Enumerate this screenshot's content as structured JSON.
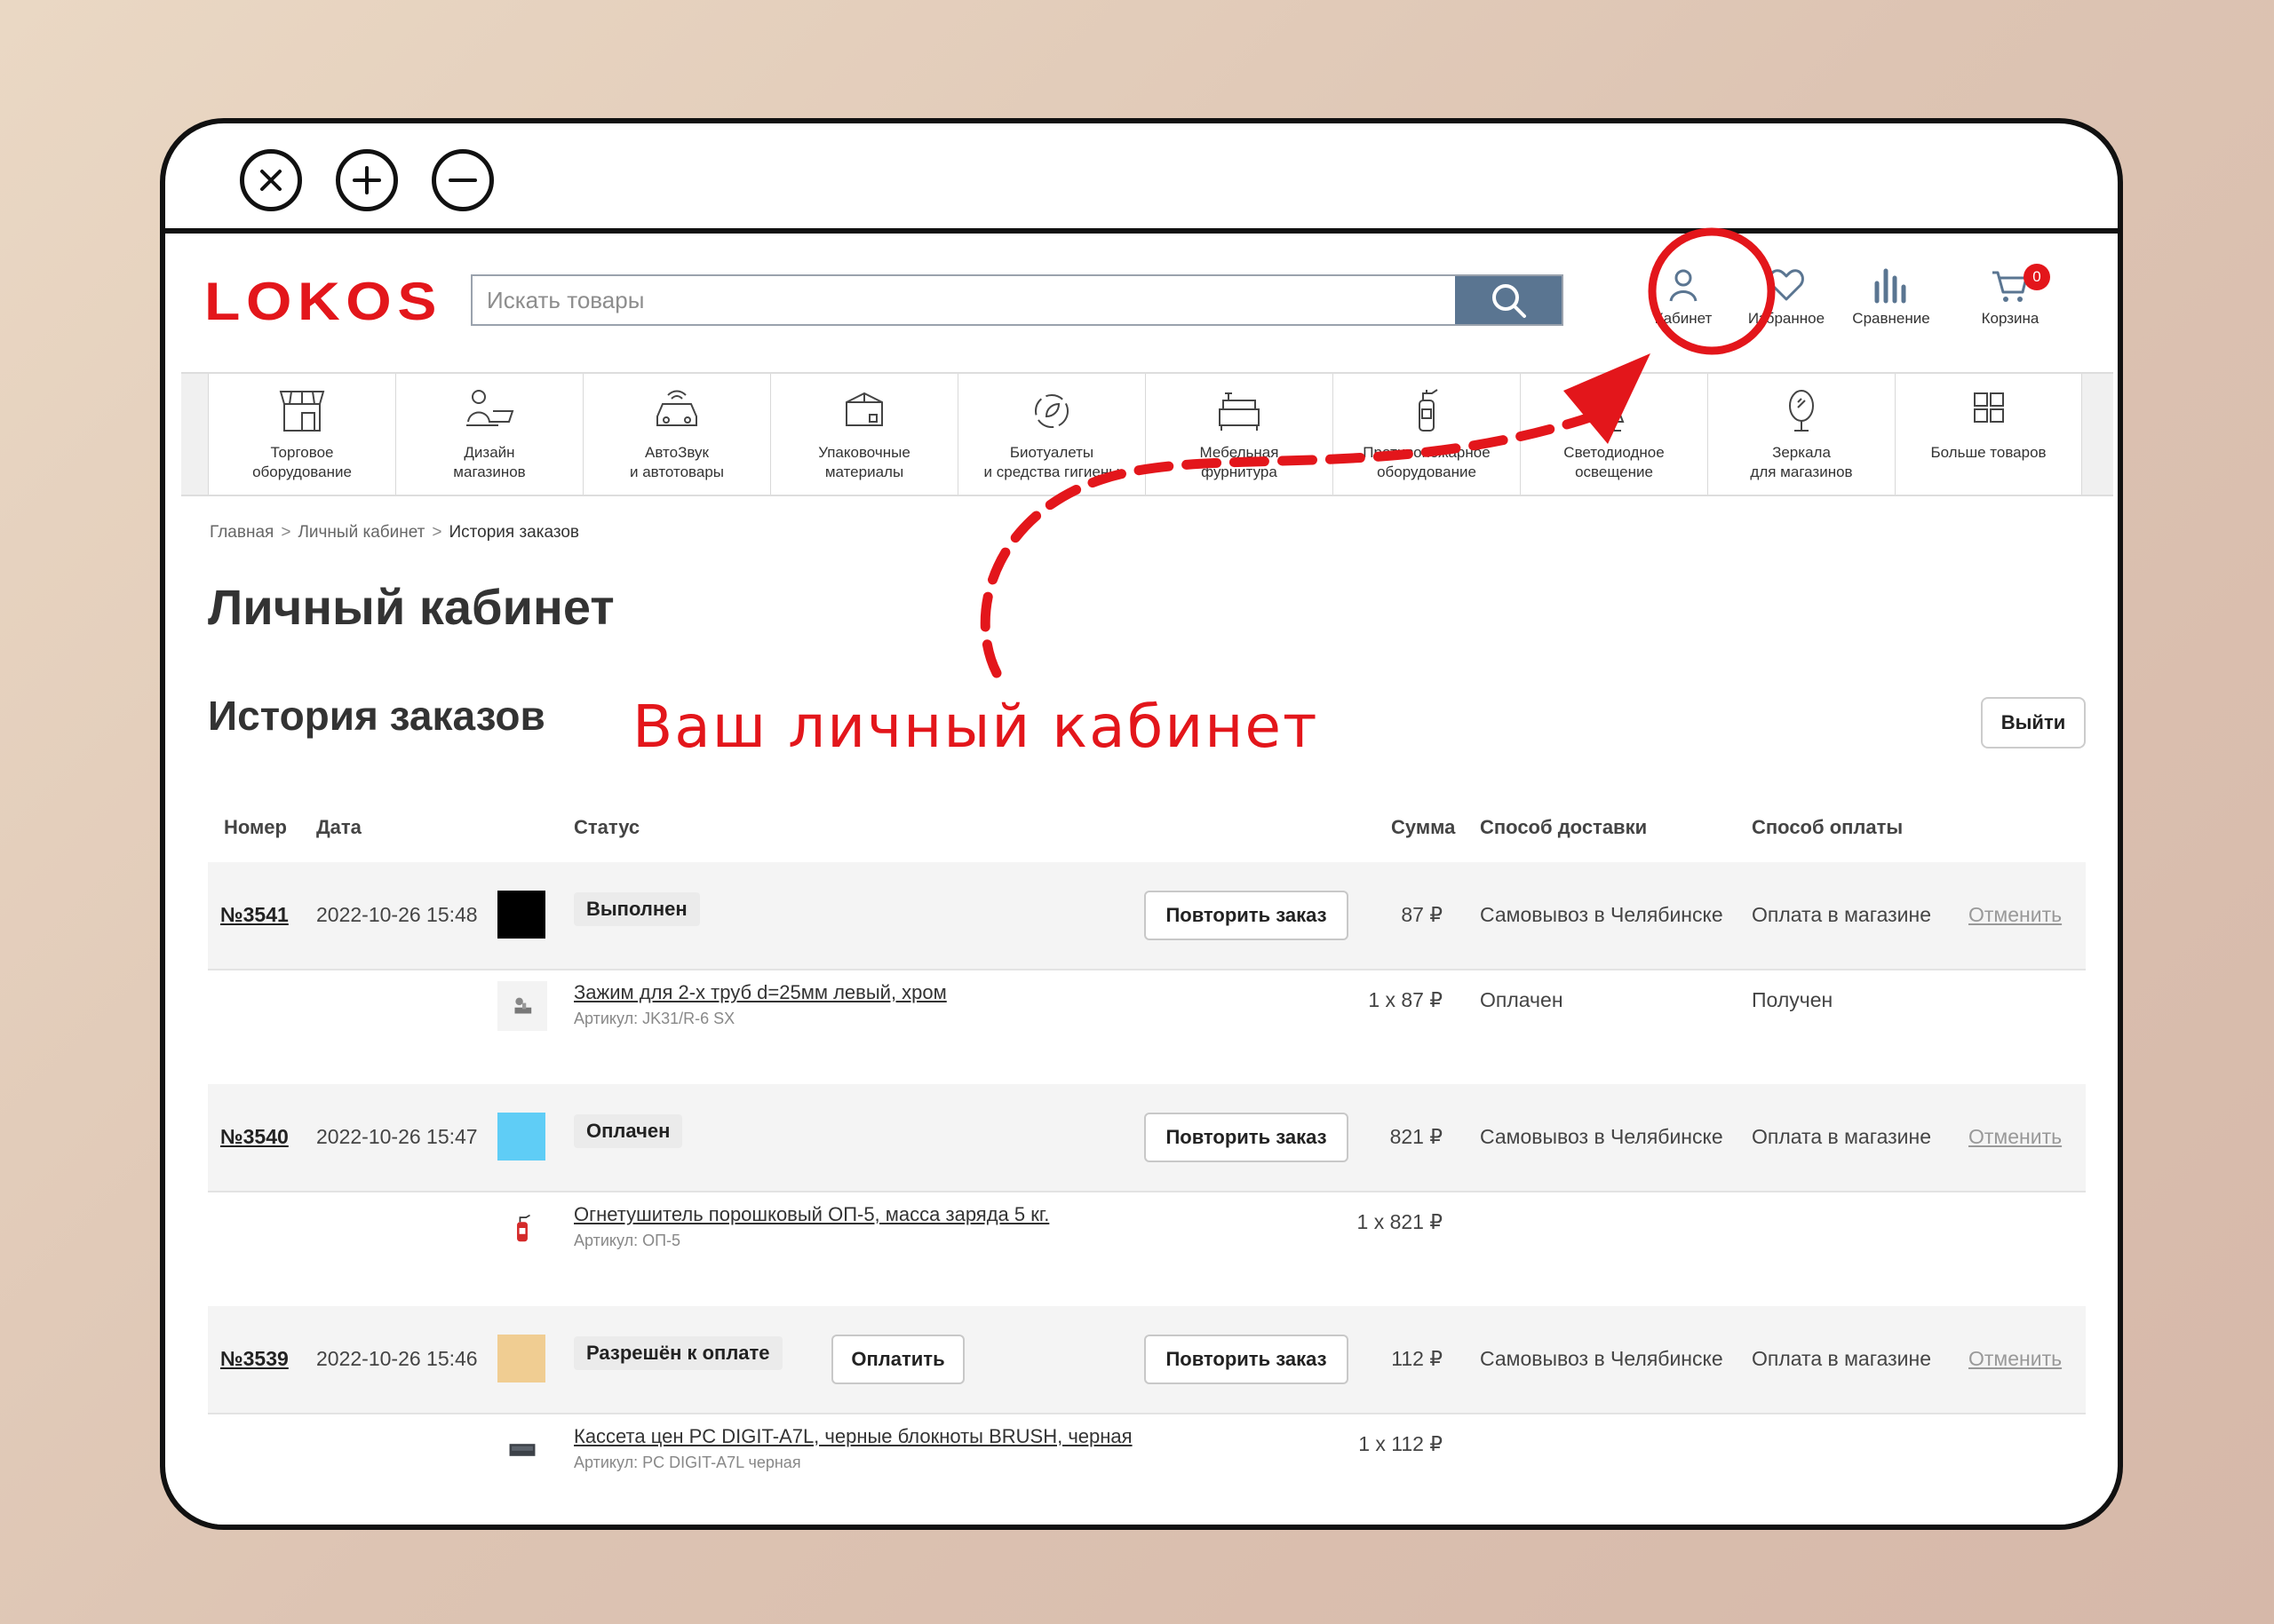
{
  "window_controls": {
    "close_icon": "close-icon",
    "zoom_in_icon": "plus-icon",
    "zoom_out_icon": "minus-icon"
  },
  "header": {
    "logo_text": "LOKOS",
    "search_placeholder": "Искать товары",
    "cabinet_label": "Кабинет",
    "favorites_label": "Избранное",
    "compare_label": "Сравнение",
    "cart_label": "Корзина",
    "cart_count": "0",
    "accent_color": "#e3161b",
    "search_button_color": "#5a7591"
  },
  "categories": [
    {
      "line1": "Торговое",
      "line2": "оборудование"
    },
    {
      "line1": "Дизайн",
      "line2": "магазинов"
    },
    {
      "line1": "АвтоЗвук",
      "line2": "и автотовары"
    },
    {
      "line1": "Упаковочные",
      "line2": "материалы"
    },
    {
      "line1": "Биотуалеты",
      "line2": "и средства гигиены"
    },
    {
      "line1": "Мебельная",
      "line2": "фурнитура"
    },
    {
      "line1": "Противопожарное",
      "line2": "оборудование"
    },
    {
      "line1": "Светодиодное",
      "line2": "освещение"
    },
    {
      "line1": "Зеркала",
      "line2": "для магазинов"
    },
    {
      "line1": "Больше товаров",
      "line2": ""
    }
  ],
  "breadcrumb": {
    "home": "Главная",
    "sep": ">",
    "cabinet": "Личный кабинет",
    "current": "История заказов"
  },
  "page_title": "Личный кабинет",
  "section_title": "История заказов",
  "logout_label": "Выйти",
  "table_headers": {
    "number": "Номер",
    "date": "Дата",
    "status": "Статус",
    "sum": "Сумма",
    "delivery": "Способ доставки",
    "payment": "Способ оплаты"
  },
  "orders": [
    {
      "number": "№3541",
      "date": "2022-10-26 15:48",
      "swatch": "#000000",
      "status": "Выполнен",
      "repeat": "Повторить заказ",
      "sum": "87 ₽",
      "delivery": "Самовывоз в Челябинске",
      "payment": "Оплата в магазине",
      "cancel": "Отменить",
      "item": {
        "name": "Зажим для 2-х труб d=25мм левый, хром",
        "article": "Артикул: JK31/R-6 SX",
        "qty": "1 x 87 ₽",
        "pay_status": "Оплачен",
        "delivery_status": "Получен"
      }
    },
    {
      "number": "№3540",
      "date": "2022-10-26 15:47",
      "swatch": "#5fcdf6",
      "status": "Оплачен",
      "repeat": "Повторить заказ",
      "sum": "821 ₽",
      "delivery": "Самовывоз в Челябинске",
      "payment": "Оплата в магазине",
      "cancel": "Отменить",
      "item": {
        "name": "Огнетушитель порошковый ОП-5, масса заряда 5 кг.",
        "article": "Артикул: ОП-5",
        "qty": "1 x 821 ₽",
        "pay_status": "",
        "delivery_status": ""
      }
    },
    {
      "number": "№3539",
      "date": "2022-10-26 15:46",
      "swatch": "#f0cd92",
      "status": "Разрешён к оплате",
      "pay_btn": "Оплатить",
      "repeat": "Повторить заказ",
      "sum": "112 ₽",
      "delivery": "Самовывоз в Челябинске",
      "payment": "Оплата в магазине",
      "cancel": "Отменить",
      "item": {
        "name": "Кассета цен PC DIGIT-A7L, черные блокноты BRUSH, черная",
        "article": "Артикул: PC DIGIT-A7L черная",
        "qty": "1 x 112 ₽",
        "pay_status": "",
        "delivery_status": ""
      }
    }
  ],
  "annotation": {
    "text": "Ваш личный кабинет",
    "color": "#e3161b"
  }
}
